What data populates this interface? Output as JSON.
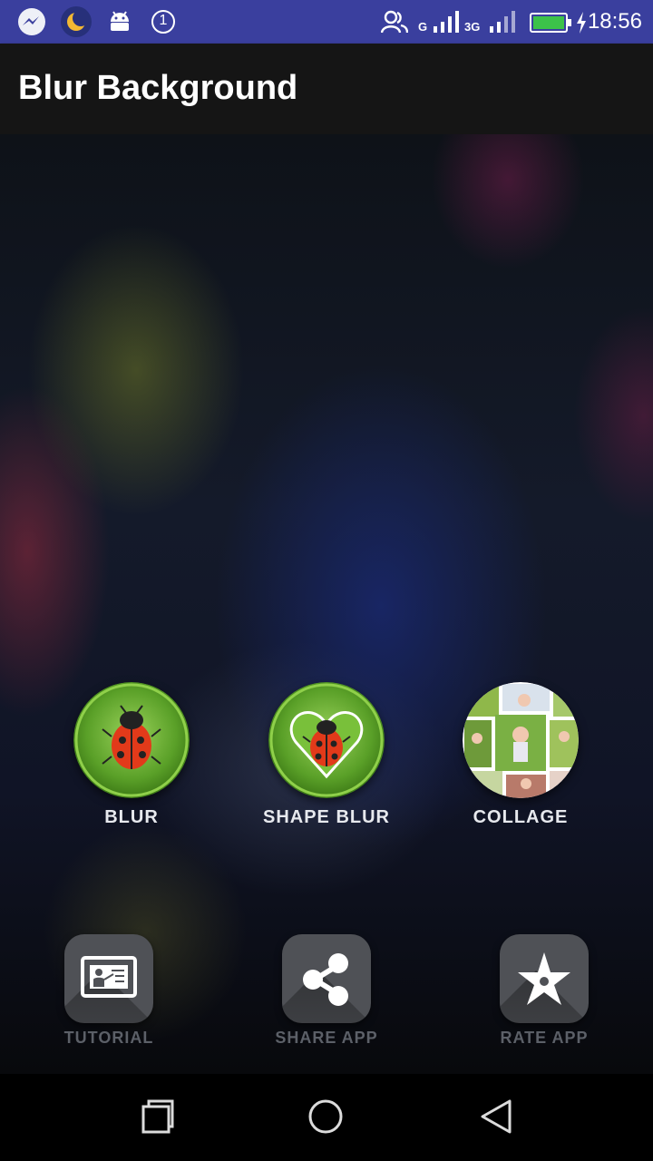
{
  "status_bar": {
    "time": "18:56",
    "notification_count": "1",
    "network_label_1": "G",
    "network_label_2": "3G",
    "icons": [
      "messenger-icon",
      "night-mode-icon",
      "android-icon",
      "notification-count-icon",
      "contacts-icon",
      "signal-icon",
      "battery-icon",
      "charging-icon"
    ]
  },
  "app_bar": {
    "title": "Blur Background"
  },
  "features": [
    {
      "label": "BLUR",
      "icon": "ladybug-icon"
    },
    {
      "label": "SHAPE BLUR",
      "icon": "ladybug-heart-icon"
    },
    {
      "label": "COLLAGE",
      "icon": "photo-collage-icon"
    }
  ],
  "actions": [
    {
      "label": "TUTORIAL",
      "icon": "presentation-icon"
    },
    {
      "label": "SHARE APP",
      "icon": "share-icon"
    },
    {
      "label": "RATE APP",
      "icon": "star-icon"
    }
  ],
  "nav_bar": {
    "icons": [
      "recents-icon",
      "home-icon",
      "back-icon"
    ]
  },
  "colors": {
    "status_bar": "#3a3f9e",
    "app_bar": "#151515",
    "feature_label": "#e7e9ee",
    "action_label": "#5c6068",
    "action_tile": "#4f5156",
    "battery": "#3cc24a"
  }
}
